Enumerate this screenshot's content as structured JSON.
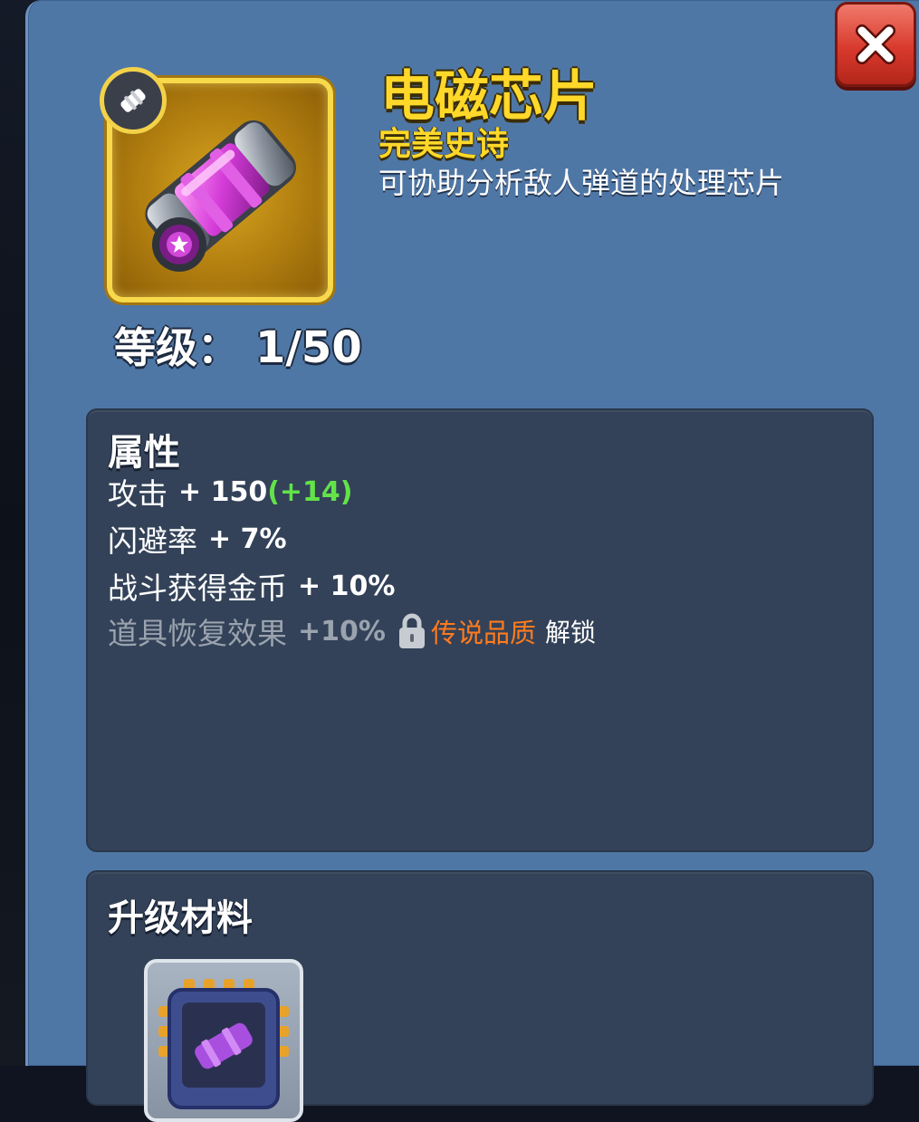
{
  "item": {
    "name": "电磁芯片",
    "rarity": "完美史诗",
    "description": "可协助分析敌人弹道的处理芯片",
    "level_label": "等级：",
    "level_value": "1/50",
    "icon": "pink-canister-chip"
  },
  "attributes": {
    "title": "属性",
    "rows": [
      {
        "name": "攻击",
        "value": "+ 150",
        "bonus": "(+14)"
      },
      {
        "name": "闪避率",
        "value": "+ 7%"
      },
      {
        "name": "战斗获得金币",
        "value": "+ 10%"
      }
    ],
    "locked_row": {
      "name": "道具恢复效果",
      "value": "+10%",
      "quality": "传说品质",
      "unlock": "解锁"
    }
  },
  "materials": {
    "title": "升级材料",
    "items": [
      {
        "icon": "chip-material-icon"
      }
    ]
  },
  "colors": {
    "panel": "#4f77a6",
    "title_gold": "#ffd82a",
    "bonus_green": "#63e24a",
    "quality_orange": "#ff7a1e",
    "close_red": "#d83a2c"
  }
}
